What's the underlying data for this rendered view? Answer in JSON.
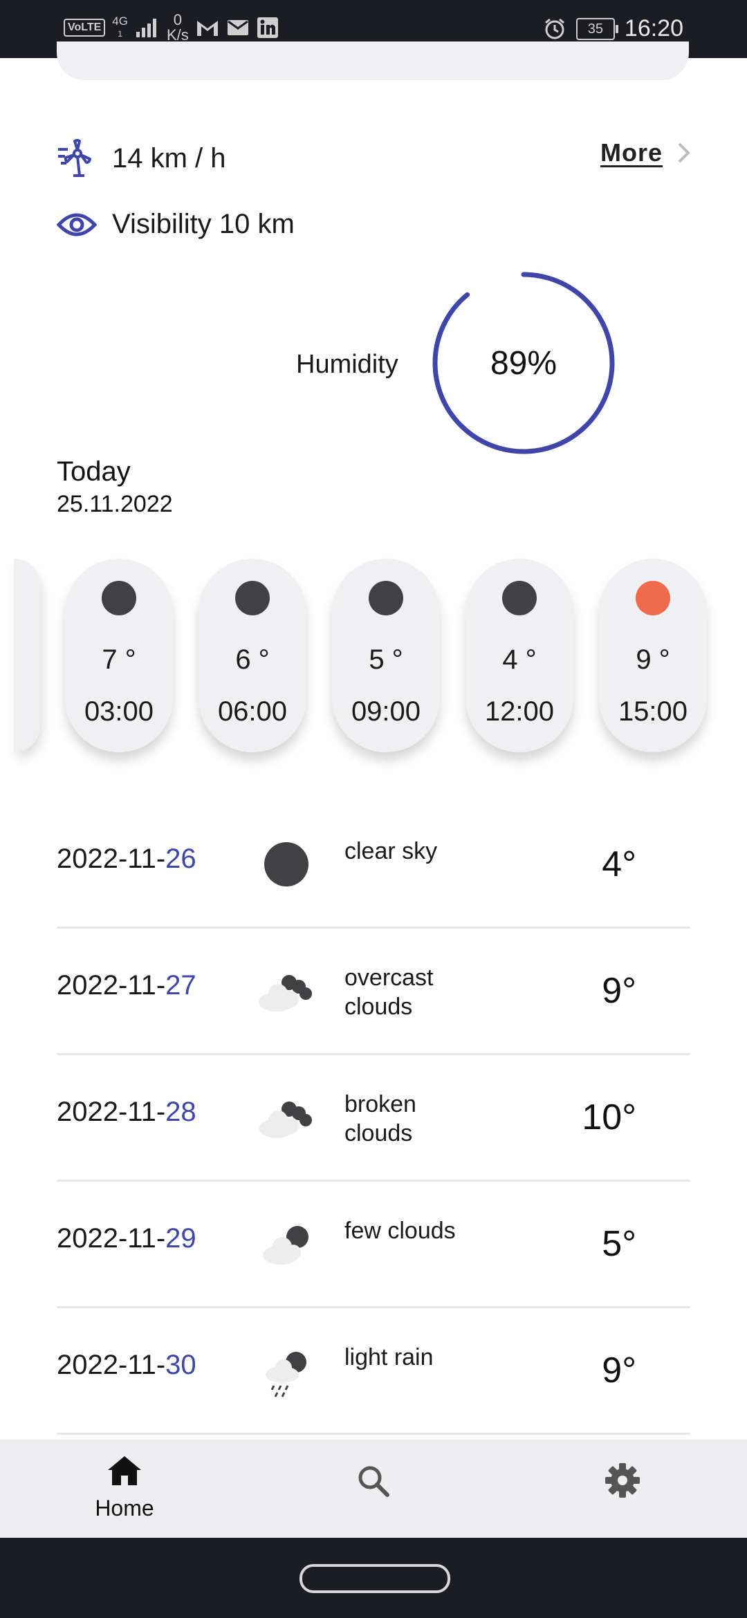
{
  "status_bar": {
    "volte": "VoLTE",
    "network_top": "4G",
    "network_bottom": "1",
    "speed_value": "0",
    "speed_unit": "K/s",
    "battery": "35",
    "time": "16:20"
  },
  "details": {
    "wind": "14 km / h",
    "more_label": "More",
    "visibility": "Visibility 10 km",
    "humidity_label": "Humidity",
    "humidity_value": "89%",
    "humidity_fraction": 0.89,
    "accent_color": "#3f46a8"
  },
  "today": {
    "title": "Today",
    "date": "25.11.2022"
  },
  "hourly": [
    {
      "temp": "7 °",
      "hour": "03:00",
      "icon": "moon-icon",
      "color": "#414143"
    },
    {
      "temp": "6 °",
      "hour": "06:00",
      "icon": "moon-icon",
      "color": "#414143"
    },
    {
      "temp": "5 °",
      "hour": "09:00",
      "icon": "moon-icon",
      "color": "#414143"
    },
    {
      "temp": "4 °",
      "hour": "12:00",
      "icon": "moon-icon",
      "color": "#414143"
    },
    {
      "temp": "9 °",
      "hour": "15:00",
      "icon": "sun-icon",
      "color": "#ef6a4a"
    }
  ],
  "forecast": [
    {
      "date_prefix": "2022-11-",
      "day": "26",
      "desc": "clear sky",
      "temp": "4°",
      "icon": "moon-icon"
    },
    {
      "date_prefix": "2022-11-",
      "day": "27",
      "desc": "overcast clouds",
      "temp": "9°",
      "icon": "overcast-clouds-icon"
    },
    {
      "date_prefix": "2022-11-",
      "day": "28",
      "desc": "broken clouds",
      "temp": "10°",
      "icon": "broken-clouds-icon"
    },
    {
      "date_prefix": "2022-11-",
      "day": "29",
      "desc": "few clouds",
      "temp": "5°",
      "icon": "few-clouds-icon"
    },
    {
      "date_prefix": "2022-11-",
      "day": "30",
      "desc": "light rain",
      "temp": "9°",
      "icon": "light-rain-icon"
    }
  ],
  "nav": {
    "home_label": "Home",
    "home_icon": "home-icon",
    "search_icon": "search-icon",
    "settings_icon": "gear-icon"
  }
}
